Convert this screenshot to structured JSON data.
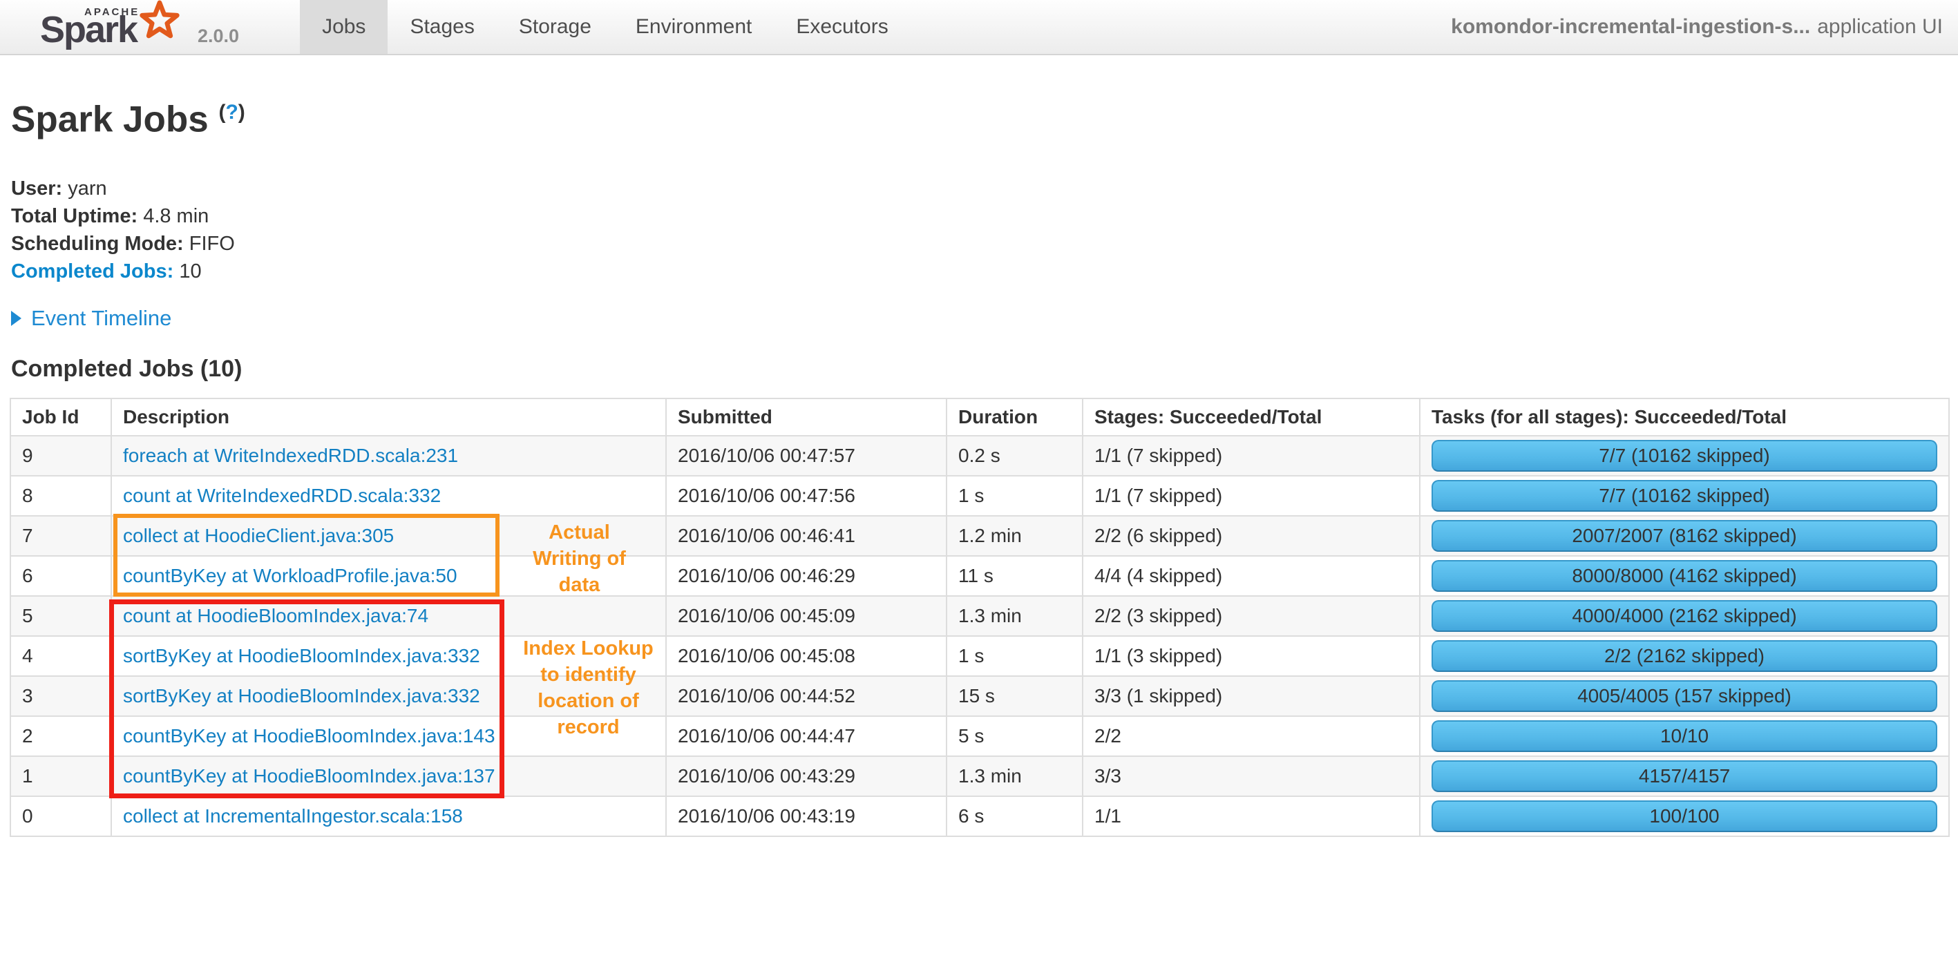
{
  "nav": {
    "logo": {
      "apache": "APACHE",
      "brand": "Spark",
      "version": "2.0.0"
    },
    "tabs": [
      {
        "label": "Jobs"
      },
      {
        "label": "Stages"
      },
      {
        "label": "Storage"
      },
      {
        "label": "Environment"
      },
      {
        "label": "Executors"
      }
    ],
    "app_name": "komondor-incremental-ingestion-s...",
    "app_suffix": "application UI"
  },
  "page": {
    "title": "Spark Jobs",
    "help_open": "(",
    "help_mark": "?",
    "help_close": ")",
    "info": [
      {
        "label": "User:",
        "value": "yarn"
      },
      {
        "label": "Total Uptime:",
        "value": "4.8 min"
      },
      {
        "label": "Scheduling Mode:",
        "value": "FIFO"
      },
      {
        "label": "Completed Jobs:",
        "value": "10"
      }
    ],
    "event_timeline_label": "Event Timeline",
    "section_heading": "Completed Jobs (10)"
  },
  "table": {
    "columns": [
      "Job Id",
      "Description",
      "Submitted",
      "Duration",
      "Stages: Succeeded/Total",
      "Tasks (for all stages): Succeeded/Total"
    ],
    "rows": [
      {
        "job_id": "9",
        "description": "foreach at WriteIndexedRDD.scala:231",
        "submitted": "2016/10/06 00:47:57",
        "duration": "0.2 s",
        "stages": "1/1 (7 skipped)",
        "tasks": "7/7 (10162 skipped)"
      },
      {
        "job_id": "8",
        "description": "count at WriteIndexedRDD.scala:332",
        "submitted": "2016/10/06 00:47:56",
        "duration": "1 s",
        "stages": "1/1 (7 skipped)",
        "tasks": "7/7 (10162 skipped)"
      },
      {
        "job_id": "7",
        "description": "collect at HoodieClient.java:305",
        "submitted": "2016/10/06 00:46:41",
        "duration": "1.2 min",
        "stages": "2/2 (6 skipped)",
        "tasks": "2007/2007 (8162 skipped)"
      },
      {
        "job_id": "6",
        "description": "countByKey at WorkloadProfile.java:50",
        "submitted": "2016/10/06 00:46:29",
        "duration": "11 s",
        "stages": "4/4 (4 skipped)",
        "tasks": "8000/8000 (4162 skipped)"
      },
      {
        "job_id": "5",
        "description": "count at HoodieBloomIndex.java:74",
        "submitted": "2016/10/06 00:45:09",
        "duration": "1.3 min",
        "stages": "2/2 (3 skipped)",
        "tasks": "4000/4000 (2162 skipped)"
      },
      {
        "job_id": "4",
        "description": "sortByKey at HoodieBloomIndex.java:332",
        "submitted": "2016/10/06 00:45:08",
        "duration": "1 s",
        "stages": "1/1 (3 skipped)",
        "tasks": "2/2 (2162 skipped)"
      },
      {
        "job_id": "3",
        "description": "sortByKey at HoodieBloomIndex.java:332",
        "submitted": "2016/10/06 00:44:52",
        "duration": "15 s",
        "stages": "3/3 (1 skipped)",
        "tasks": "4005/4005 (157 skipped)"
      },
      {
        "job_id": "2",
        "description": "countByKey at HoodieBloomIndex.java:143",
        "submitted": "2016/10/06 00:44:47",
        "duration": "5 s",
        "stages": "2/2",
        "tasks": "10/10"
      },
      {
        "job_id": "1",
        "description": "countByKey at HoodieBloomIndex.java:137",
        "submitted": "2016/10/06 00:43:29",
        "duration": "1.3 min",
        "stages": "3/3",
        "tasks": "4157/4157"
      },
      {
        "job_id": "0",
        "description": "collect at IncrementalIngestor.scala:158",
        "submitted": "2016/10/06 00:43:19",
        "duration": "6 s",
        "stages": "1/1",
        "tasks": "100/100"
      }
    ]
  },
  "annotations": {
    "write_label": "Actual Writing of data",
    "index_label": "Index Lookup to identify location of record",
    "orange_color": "#f7941e",
    "red_color": "#ee1e16"
  },
  "colors": {
    "link_blue": "#1380c3",
    "accent_blue": "#0b87cc",
    "bar_blue_top": "#67c8f3",
    "bar_blue_bottom": "#44a7dc",
    "nav_active_bg": "#dcdcdc",
    "table_border": "#dddddd",
    "stripe_bg": "#f7f7f7"
  }
}
